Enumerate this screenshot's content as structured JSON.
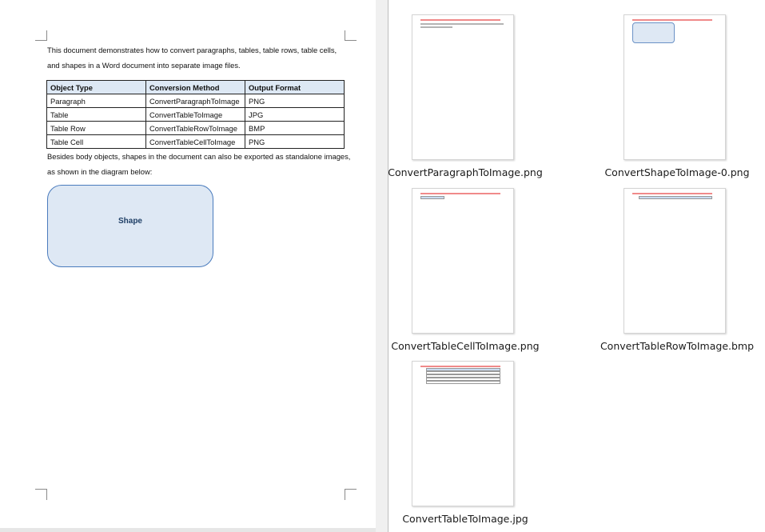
{
  "document": {
    "intro": "This document demonstrates how to convert paragraphs, tables, table rows, table cells, and shapes in a Word document into separate image files.",
    "table": {
      "headers": [
        "Object Type",
        "Conversion Method",
        "Output Format"
      ],
      "rows": [
        [
          "Paragraph",
          "ConvertParagraphToImage",
          "PNG"
        ],
        [
          "Table",
          "ConvertTableToImage",
          "JPG"
        ],
        [
          "Table Row",
          "ConvertTableRowToImage",
          "BMP"
        ],
        [
          "Table Cell",
          "ConvertTableCellToImage",
          "PNG"
        ]
      ]
    },
    "besides": "Besides body objects, shapes in the document can also be exported as standalone images, as shown in the diagram below:",
    "shape_label": "Shape"
  },
  "files": [
    {
      "name": "ConvertParagraphToImage.png"
    },
    {
      "name": "ConvertShapeToImage-0.png"
    },
    {
      "name": "ConvertTableCellToImage.png"
    },
    {
      "name": "ConvertTableRowToImage.bmp"
    },
    {
      "name": "ConvertTableToImage.jpg"
    }
  ],
  "colors": {
    "shape_fill": "#dee8f4",
    "shape_border": "#4a7bbd",
    "table_header": "#dde8f4",
    "warning_text": "#f08a8a"
  }
}
